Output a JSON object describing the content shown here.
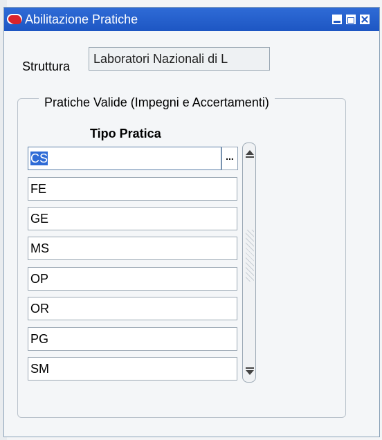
{
  "window": {
    "title": "Abilitazione Pratiche",
    "icons": {
      "app": "oracle-app-icon",
      "minimize": "minimize-icon",
      "maximize": "maximize-icon",
      "close": "close-icon"
    }
  },
  "form": {
    "struttura_label": "Struttura",
    "struttura_value": "Laboratori Nazionali di L",
    "group_title": "Pratiche Valide (Impegni e Accertamenti)",
    "column_header": "Tipo Pratica",
    "lov_button_label": "...",
    "rows": [
      "CS",
      "FE",
      "GE",
      "MS",
      "OP",
      "OR",
      "PG",
      "SM"
    ]
  },
  "colors": {
    "titlebar": "#1d56c3",
    "selection": "#2f6bd6",
    "app_icon": "#d9232b"
  }
}
